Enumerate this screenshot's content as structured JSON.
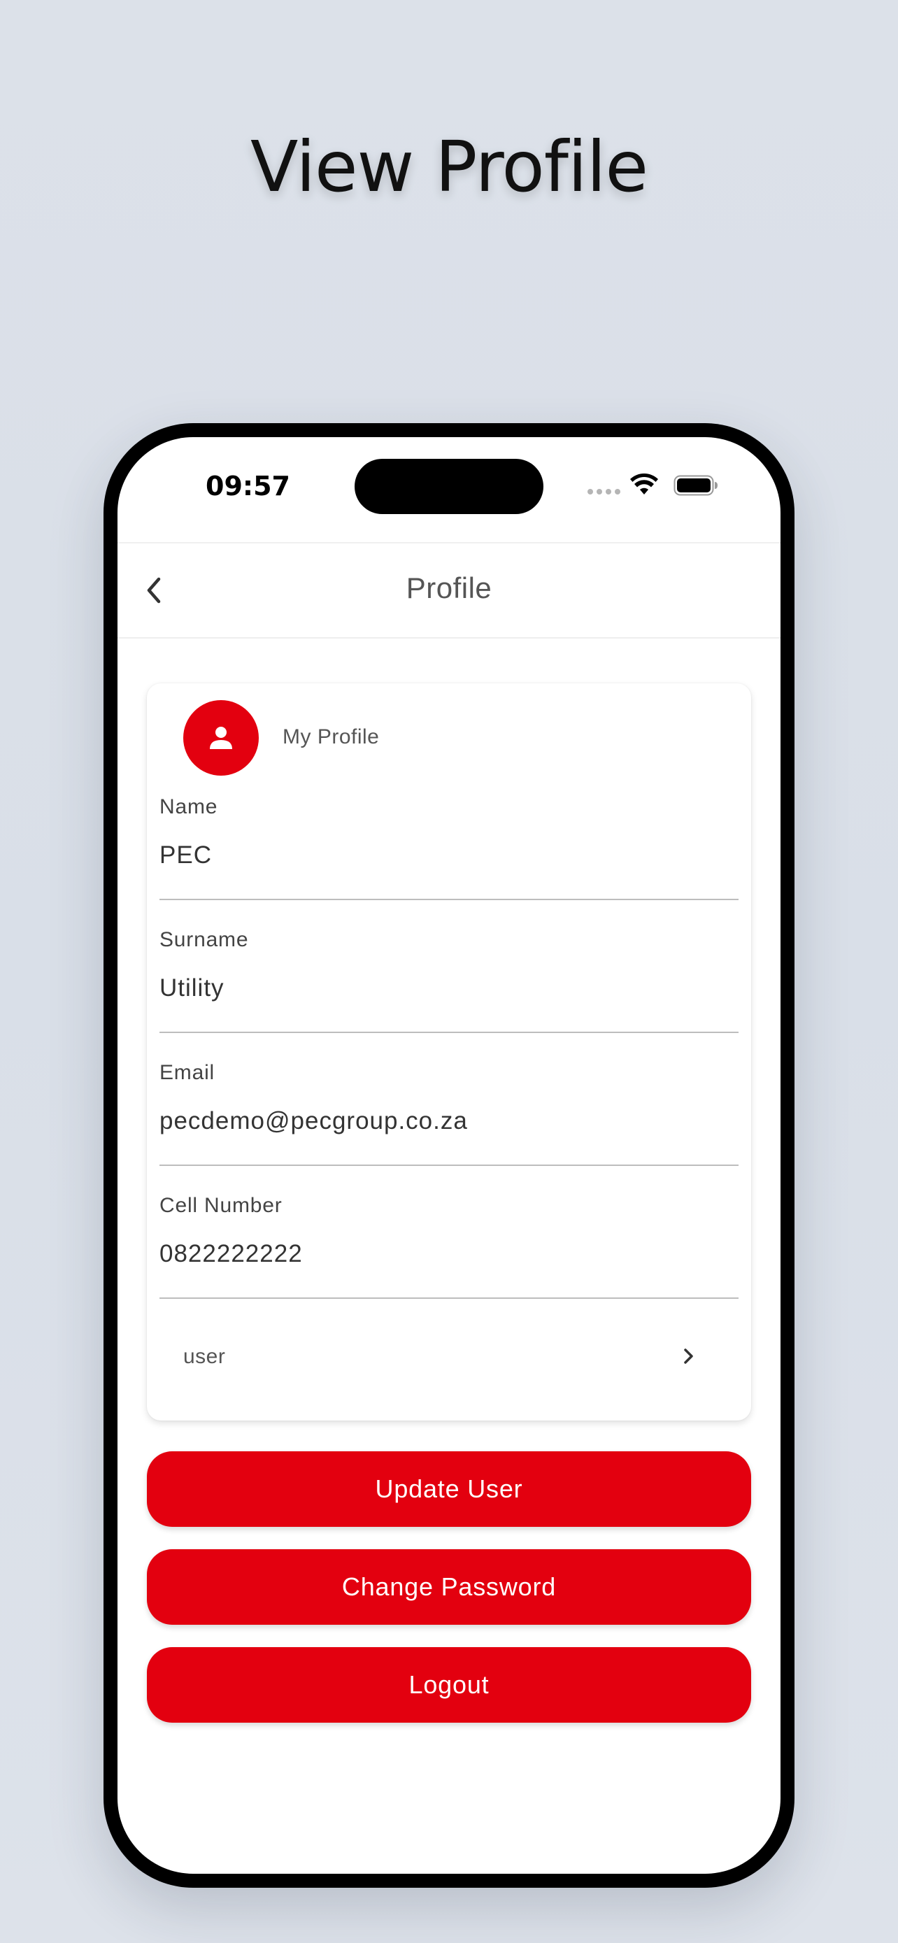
{
  "headline": "View Profile",
  "status_bar": {
    "time": "09:57"
  },
  "nav": {
    "title": "Profile"
  },
  "profile_card": {
    "title": "My Profile",
    "fields": [
      {
        "label": "Name",
        "value": "PEC"
      },
      {
        "label": "Surname",
        "value": "Utility"
      },
      {
        "label": "Email",
        "value": "pecdemo@pecgroup.co.za"
      },
      {
        "label": "Cell Number",
        "value": "0822222222"
      }
    ],
    "role": "user"
  },
  "buttons": {
    "update": "Update User",
    "change_password": "Change Password",
    "logout": "Logout"
  },
  "colors": {
    "accent": "#e3000f",
    "background": "#dce1e9"
  },
  "icons": {
    "back": "chevron-left-icon",
    "avatar": "person-icon",
    "role_chevron": "chevron-right-icon",
    "wifi": "wifi-icon",
    "battery": "battery-icon"
  }
}
